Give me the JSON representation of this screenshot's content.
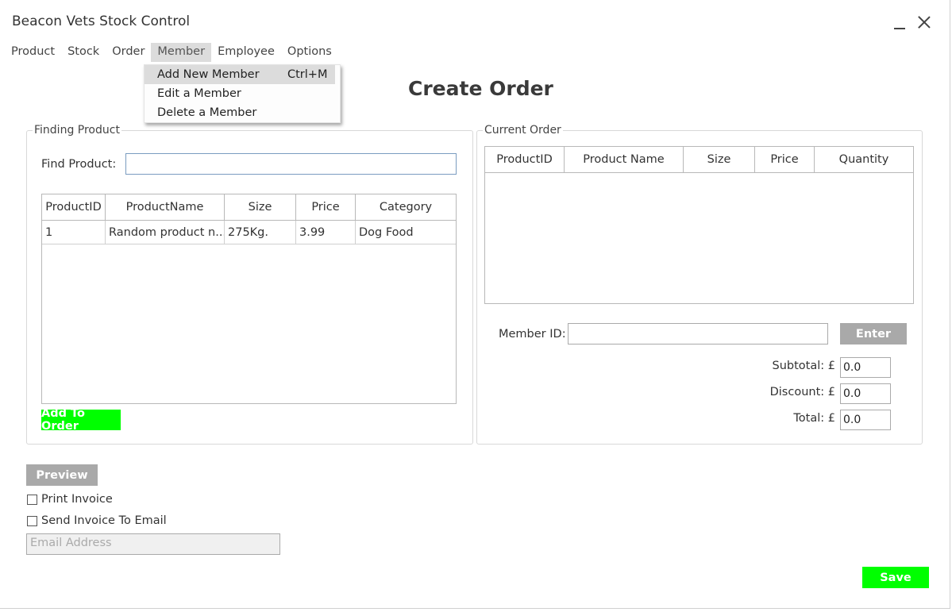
{
  "window": {
    "title": "Beacon Vets Stock Control"
  },
  "menu": [
    "Product",
    "Stock",
    "Order",
    "Member",
    "Employee",
    "Options"
  ],
  "member_menu": {
    "items": [
      {
        "label": "Add New Member",
        "shortcut": "Ctrl+M"
      },
      {
        "label": "Edit a Member",
        "shortcut": ""
      },
      {
        "label": "Delete a Member",
        "shortcut": ""
      }
    ]
  },
  "page": {
    "title": "Create Order"
  },
  "finding": {
    "group_label": "Finding Product",
    "find_label": "Find Product:",
    "find_value": "",
    "columns": [
      "ProductID",
      "ProductName",
      "Size",
      "Price",
      "Category"
    ],
    "rows": [
      [
        "1",
        "Random product n...",
        "275Kg.",
        "3.99",
        "Dog Food"
      ]
    ],
    "add_button": "Add To Order"
  },
  "current_order": {
    "group_label": "Current Order",
    "columns": [
      "ProductID",
      "Product Name",
      "Size",
      "Price",
      "Quantity"
    ],
    "member_label": "Member ID:",
    "member_value": "",
    "enter_button": "Enter",
    "subtotal_label": "Subtotal: £",
    "subtotal_value": "0.0",
    "discount_label": "Discount: £",
    "discount_value": "0.0",
    "total_label": "Total: £",
    "total_value": "0.0"
  },
  "invoice": {
    "preview_button": "Preview",
    "print_label": "Print Invoice",
    "email_label": "Send Invoice To Email",
    "email_placeholder": "Email Address"
  },
  "save_button": "Save",
  "colors": {
    "green": "#00ff00",
    "gray_button": "#a9a9a9"
  }
}
